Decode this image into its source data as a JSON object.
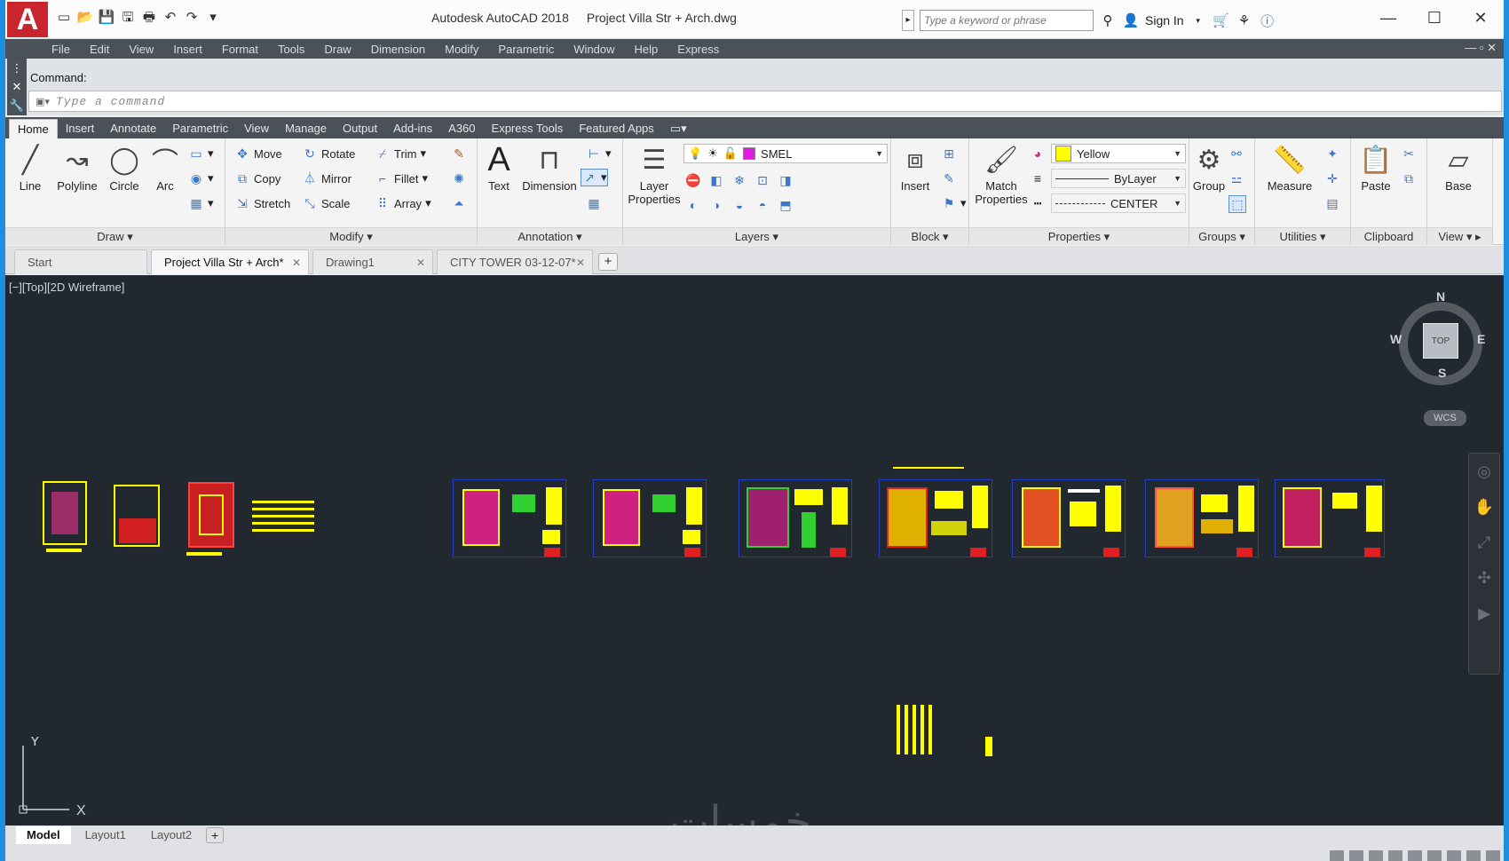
{
  "window": {
    "app_title": "Autodesk AutoCAD 2018",
    "file_title": "Project Villa Str + Arch.dwg",
    "logo_letter": "A",
    "search_placeholder": "Type a keyword or phrase",
    "sign_in": "Sign In",
    "controls": [
      "—",
      "☐",
      "✕"
    ]
  },
  "menubar": [
    "File",
    "Edit",
    "View",
    "Insert",
    "Format",
    "Tools",
    "Draw",
    "Dimension",
    "Modify",
    "Parametric",
    "Window",
    "Help",
    "Express"
  ],
  "command": {
    "label": "Command:",
    "placeholder": "Type a command"
  },
  "ribbon_tabs": [
    "Home",
    "Insert",
    "Annotate",
    "Parametric",
    "View",
    "Manage",
    "Output",
    "Add-ins",
    "A360",
    "Express Tools",
    "Featured Apps"
  ],
  "ribbon": {
    "draw": {
      "title": "Draw",
      "line": "Line",
      "polyline": "Polyline",
      "circle": "Circle",
      "arc": "Arc"
    },
    "modify": {
      "title": "Modify",
      "move": "Move",
      "rotate": "Rotate",
      "trim": "Trim",
      "copy": "Copy",
      "mirror": "Mirror",
      "fillet": "Fillet",
      "stretch": "Stretch",
      "scale": "Scale",
      "array": "Array"
    },
    "annotation": {
      "title": "Annotation",
      "text": "Text",
      "dimension": "Dimension"
    },
    "layers": {
      "title": "Layers",
      "layer_properties_1": "Layer",
      "layer_properties_2": "Properties",
      "current_layer": "SMEL",
      "layer_color": "#e01be0"
    },
    "block": {
      "title": "Block",
      "insert": "Insert"
    },
    "properties": {
      "title": "Properties",
      "match_1": "Match",
      "match_2": "Properties",
      "color": "Yellow",
      "color_hex": "#ffff00",
      "lineweight": "ByLayer",
      "linetype": "CENTER"
    },
    "groups": {
      "title": "Groups",
      "group": "Group"
    },
    "utilities": {
      "title": "Utilities",
      "measure": "Measure"
    },
    "clipboard": {
      "title": "Clipboard",
      "paste": "Paste"
    },
    "view": {
      "title": "View",
      "base": "Base"
    }
  },
  "doc_tabs": [
    {
      "label": "Start"
    },
    {
      "label": "Project Villa Str + Arch*"
    },
    {
      "label": "Drawing1"
    },
    {
      "label": "CITY TOWER 03-12-07*"
    }
  ],
  "viewport": {
    "label": "[−][Top][2D Wireframe]",
    "compass": {
      "n": "N",
      "s": "S",
      "e": "E",
      "w": "W",
      "top": "TOP"
    },
    "wcs": "WCS",
    "ucs_x": "X",
    "ucs_y": "Y"
  },
  "layout_tabs": [
    "Model",
    "Layout1",
    "Layout2"
  ],
  "watermark": "خمسات",
  "colors": {
    "canvas": "#212830",
    "sheet_border": "#2540c8",
    "yellow": "#ffff00",
    "red": "#e02020",
    "magenta": "#e01be0",
    "green": "#30d030"
  }
}
